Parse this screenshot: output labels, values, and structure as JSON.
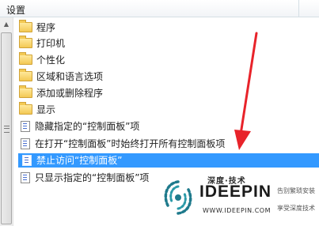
{
  "header": {
    "title": "设置"
  },
  "items": [
    {
      "type": "folder",
      "label": "程序"
    },
    {
      "type": "folder",
      "label": "打印机"
    },
    {
      "type": "folder",
      "label": "个性化"
    },
    {
      "type": "folder",
      "label": "区域和语言选项"
    },
    {
      "type": "folder",
      "label": "添加或删除程序"
    },
    {
      "type": "folder",
      "label": "显示"
    },
    {
      "type": "setting",
      "label": "隐藏指定的“控制面板”项"
    },
    {
      "type": "setting",
      "label": "在打开“控制面板”时始终打开所有控制面板项"
    },
    {
      "type": "setting",
      "label": "禁止访问“控制面板”",
      "selected": true
    },
    {
      "type": "setting",
      "label": "只显示指定的“控制面板”项"
    }
  ],
  "watermark": {
    "brand_cn": "深度·技术",
    "brand": "IDEEPIN",
    "url": "WWW.IDEEPIN.COM",
    "slogan1": "告别繁琐安装",
    "slogan2": "享受深度技术"
  },
  "colors": {
    "selection": "#3399ff",
    "arrow": "#e8232a"
  }
}
